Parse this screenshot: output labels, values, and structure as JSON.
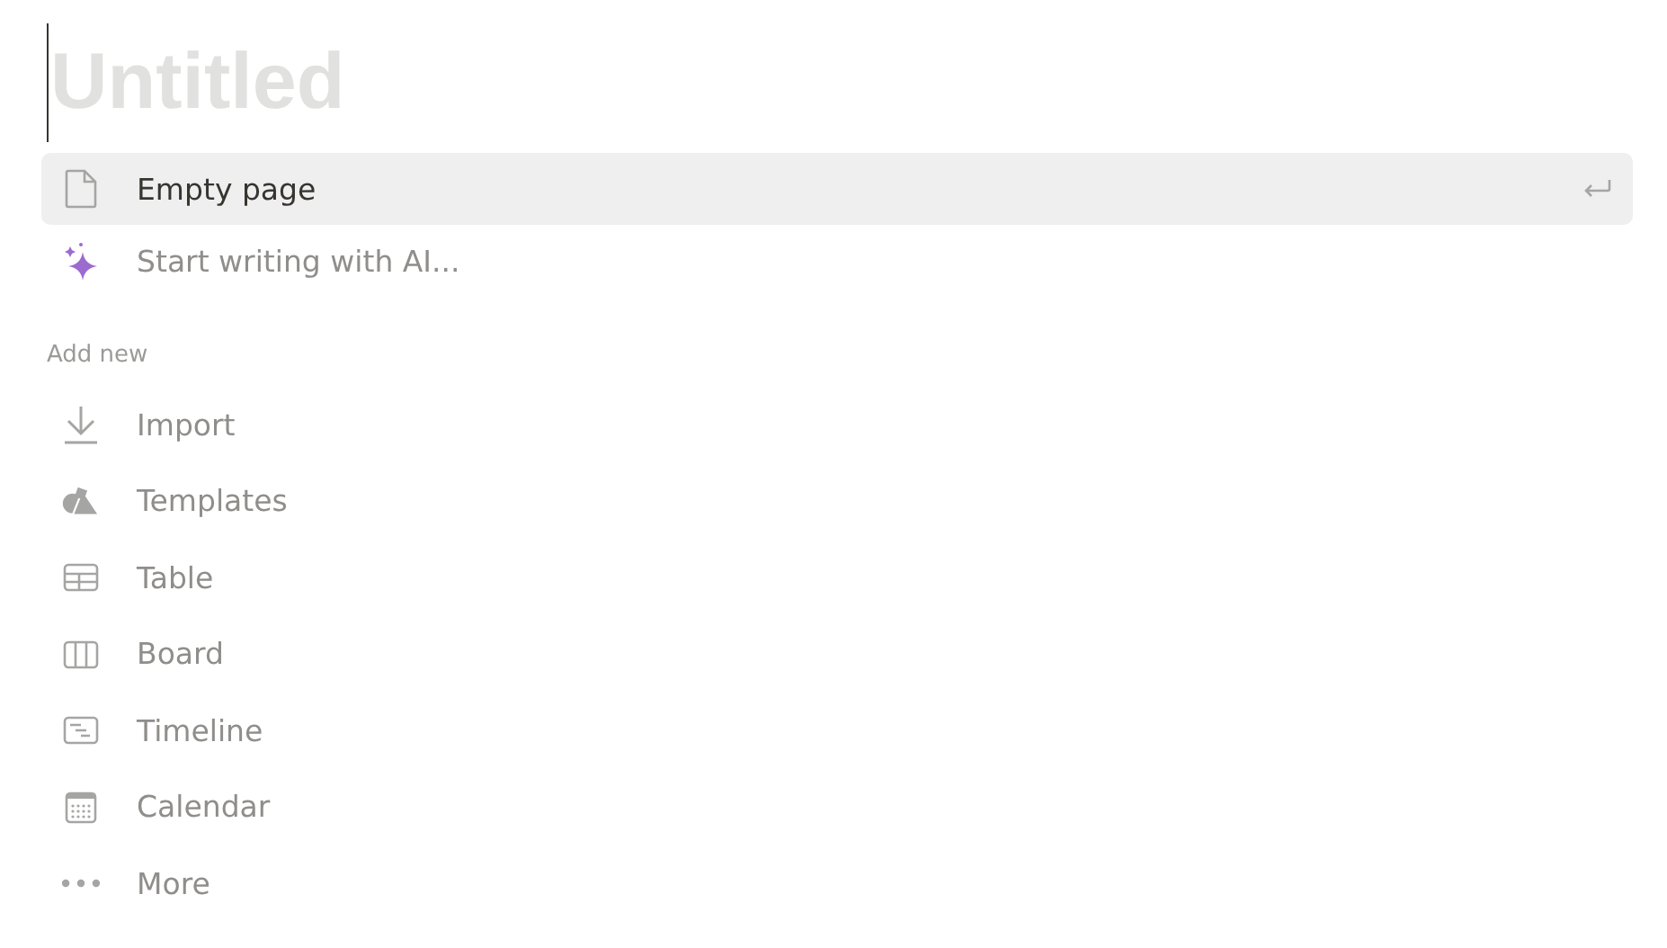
{
  "title": {
    "placeholder": "Untitled"
  },
  "options": [
    {
      "kind": "page",
      "label": "Empty page",
      "selected": true
    },
    {
      "kind": "ai",
      "label": "Start writing with AI...",
      "selected": false
    }
  ],
  "add_new": {
    "heading": "Add new",
    "items": [
      {
        "kind": "import",
        "label": "Import"
      },
      {
        "kind": "templates",
        "label": "Templates"
      },
      {
        "kind": "table",
        "label": "Table"
      },
      {
        "kind": "board",
        "label": "Board"
      },
      {
        "kind": "timeline",
        "label": "Timeline"
      },
      {
        "kind": "calendar",
        "label": "Calendar"
      },
      {
        "kind": "more",
        "label": "More"
      }
    ]
  }
}
